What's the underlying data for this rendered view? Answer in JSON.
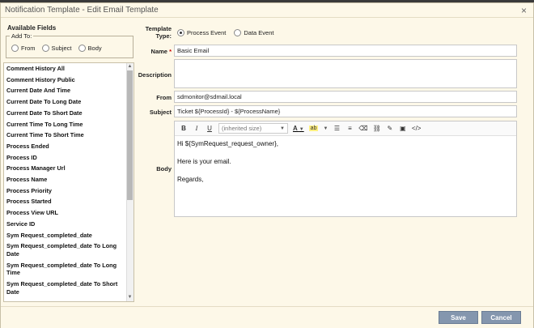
{
  "dialog": {
    "title": "Notification Template - Edit Email Template",
    "close_label": "×"
  },
  "left": {
    "header": "Available Fields",
    "add_to": {
      "legend": "Add To:",
      "options": [
        "From",
        "Subject",
        "Body"
      ]
    },
    "fields": [
      "Comment History All",
      "Comment History Public",
      "Current Date And Time",
      "Current Date To Long Date",
      "Current Date To Short Date",
      "Current Time To Long Time",
      "Current Time To Short Time",
      "Process Ended",
      "Process ID",
      "Process Manager Url",
      "Process Name",
      "Process Priority",
      "Process Started",
      "Process View URL",
      "Service ID",
      "Sym Request_completed_date",
      "Sym Request_completed_date To Long Date",
      "Sym Request_completed_date To Long Time",
      "Sym Request_completed_date To Short Date"
    ]
  },
  "form": {
    "template_type_label_1": "Template",
    "template_type_label_2": "Type:",
    "template_type_options": [
      "Process Event",
      "Data Event"
    ],
    "template_type_selected": "Process Event",
    "name_label": "Name",
    "name_required": "*",
    "name_value": "Basic Email",
    "description_label": "Description",
    "description_value": "",
    "from_label": "From",
    "from_value": "sdmonitor@sdmail.local",
    "subject_label": "Subject",
    "subject_value": "Ticket ${ProcessId} - ${ProcessName}",
    "body_label": "Body",
    "editor": {
      "bold": "B",
      "italic": "I",
      "underline": "U",
      "font_size": "(inherited size)",
      "text_color": "A",
      "highlight": "ab"
    },
    "body_lines": [
      "Hi ${SymRequest_request_owner},",
      "Here is your email.",
      "Regards,"
    ]
  },
  "footer": {
    "save_label": "Save",
    "cancel_label": "Cancel"
  },
  "colors": {
    "dialog_bg": "#fdf8e8",
    "button": "#8496ae"
  }
}
